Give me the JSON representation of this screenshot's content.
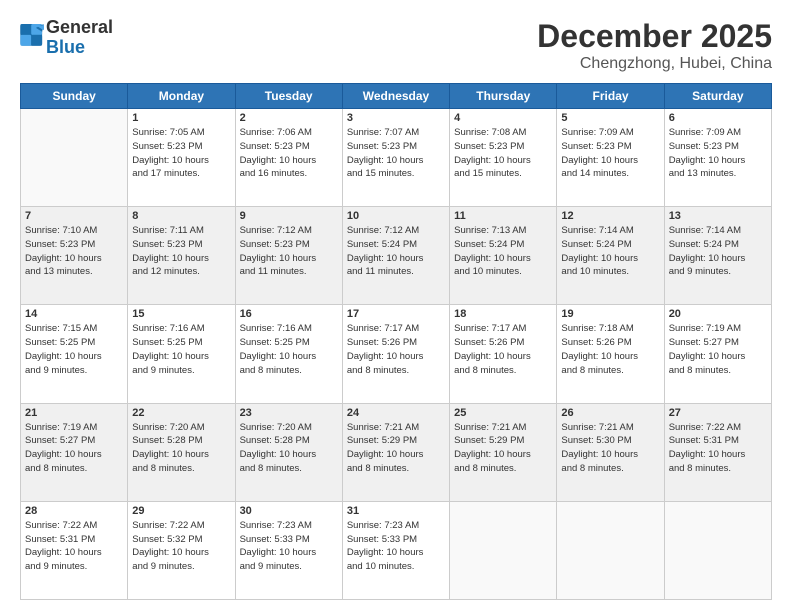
{
  "logo": {
    "general": "General",
    "blue": "Blue"
  },
  "title": "December 2025",
  "location": "Chengzhong, Hubei, China",
  "weekdays": [
    "Sunday",
    "Monday",
    "Tuesday",
    "Wednesday",
    "Thursday",
    "Friday",
    "Saturday"
  ],
  "weeks": [
    [
      {
        "day": "",
        "info": ""
      },
      {
        "day": "1",
        "info": "Sunrise: 7:05 AM\nSunset: 5:23 PM\nDaylight: 10 hours\nand 17 minutes."
      },
      {
        "day": "2",
        "info": "Sunrise: 7:06 AM\nSunset: 5:23 PM\nDaylight: 10 hours\nand 16 minutes."
      },
      {
        "day": "3",
        "info": "Sunrise: 7:07 AM\nSunset: 5:23 PM\nDaylight: 10 hours\nand 15 minutes."
      },
      {
        "day": "4",
        "info": "Sunrise: 7:08 AM\nSunset: 5:23 PM\nDaylight: 10 hours\nand 15 minutes."
      },
      {
        "day": "5",
        "info": "Sunrise: 7:09 AM\nSunset: 5:23 PM\nDaylight: 10 hours\nand 14 minutes."
      },
      {
        "day": "6",
        "info": "Sunrise: 7:09 AM\nSunset: 5:23 PM\nDaylight: 10 hours\nand 13 minutes."
      }
    ],
    [
      {
        "day": "7",
        "info": "Sunrise: 7:10 AM\nSunset: 5:23 PM\nDaylight: 10 hours\nand 13 minutes."
      },
      {
        "day": "8",
        "info": "Sunrise: 7:11 AM\nSunset: 5:23 PM\nDaylight: 10 hours\nand 12 minutes."
      },
      {
        "day": "9",
        "info": "Sunrise: 7:12 AM\nSunset: 5:23 PM\nDaylight: 10 hours\nand 11 minutes."
      },
      {
        "day": "10",
        "info": "Sunrise: 7:12 AM\nSunset: 5:24 PM\nDaylight: 10 hours\nand 11 minutes."
      },
      {
        "day": "11",
        "info": "Sunrise: 7:13 AM\nSunset: 5:24 PM\nDaylight: 10 hours\nand 10 minutes."
      },
      {
        "day": "12",
        "info": "Sunrise: 7:14 AM\nSunset: 5:24 PM\nDaylight: 10 hours\nand 10 minutes."
      },
      {
        "day": "13",
        "info": "Sunrise: 7:14 AM\nSunset: 5:24 PM\nDaylight: 10 hours\nand 9 minutes."
      }
    ],
    [
      {
        "day": "14",
        "info": "Sunrise: 7:15 AM\nSunset: 5:25 PM\nDaylight: 10 hours\nand 9 minutes."
      },
      {
        "day": "15",
        "info": "Sunrise: 7:16 AM\nSunset: 5:25 PM\nDaylight: 10 hours\nand 9 minutes."
      },
      {
        "day": "16",
        "info": "Sunrise: 7:16 AM\nSunset: 5:25 PM\nDaylight: 10 hours\nand 8 minutes."
      },
      {
        "day": "17",
        "info": "Sunrise: 7:17 AM\nSunset: 5:26 PM\nDaylight: 10 hours\nand 8 minutes."
      },
      {
        "day": "18",
        "info": "Sunrise: 7:17 AM\nSunset: 5:26 PM\nDaylight: 10 hours\nand 8 minutes."
      },
      {
        "day": "19",
        "info": "Sunrise: 7:18 AM\nSunset: 5:26 PM\nDaylight: 10 hours\nand 8 minutes."
      },
      {
        "day": "20",
        "info": "Sunrise: 7:19 AM\nSunset: 5:27 PM\nDaylight: 10 hours\nand 8 minutes."
      }
    ],
    [
      {
        "day": "21",
        "info": "Sunrise: 7:19 AM\nSunset: 5:27 PM\nDaylight: 10 hours\nand 8 minutes."
      },
      {
        "day": "22",
        "info": "Sunrise: 7:20 AM\nSunset: 5:28 PM\nDaylight: 10 hours\nand 8 minutes."
      },
      {
        "day": "23",
        "info": "Sunrise: 7:20 AM\nSunset: 5:28 PM\nDaylight: 10 hours\nand 8 minutes."
      },
      {
        "day": "24",
        "info": "Sunrise: 7:21 AM\nSunset: 5:29 PM\nDaylight: 10 hours\nand 8 minutes."
      },
      {
        "day": "25",
        "info": "Sunrise: 7:21 AM\nSunset: 5:29 PM\nDaylight: 10 hours\nand 8 minutes."
      },
      {
        "day": "26",
        "info": "Sunrise: 7:21 AM\nSunset: 5:30 PM\nDaylight: 10 hours\nand 8 minutes."
      },
      {
        "day": "27",
        "info": "Sunrise: 7:22 AM\nSunset: 5:31 PM\nDaylight: 10 hours\nand 8 minutes."
      }
    ],
    [
      {
        "day": "28",
        "info": "Sunrise: 7:22 AM\nSunset: 5:31 PM\nDaylight: 10 hours\nand 9 minutes."
      },
      {
        "day": "29",
        "info": "Sunrise: 7:22 AM\nSunset: 5:32 PM\nDaylight: 10 hours\nand 9 minutes."
      },
      {
        "day": "30",
        "info": "Sunrise: 7:23 AM\nSunset: 5:33 PM\nDaylight: 10 hours\nand 9 minutes."
      },
      {
        "day": "31",
        "info": "Sunrise: 7:23 AM\nSunset: 5:33 PM\nDaylight: 10 hours\nand 10 minutes."
      },
      {
        "day": "",
        "info": ""
      },
      {
        "day": "",
        "info": ""
      },
      {
        "day": "",
        "info": ""
      }
    ]
  ]
}
